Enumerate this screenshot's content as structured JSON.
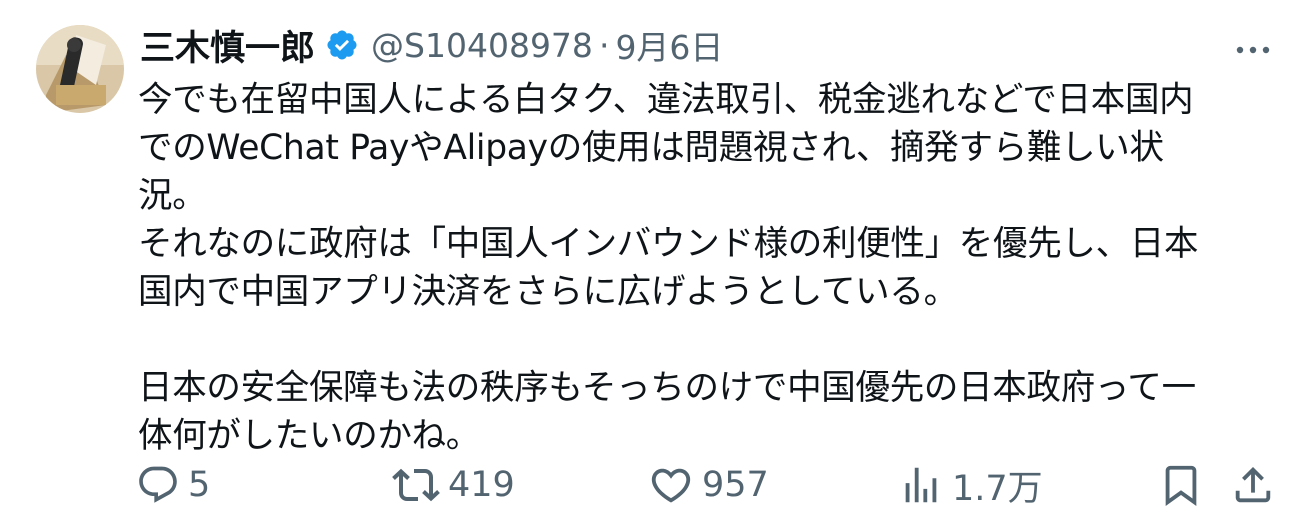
{
  "author": {
    "name": "三木慎一郎",
    "handle": "@S10408978",
    "date": "9月6日",
    "separator": "·",
    "verified": true,
    "verified_color": "#1d9bf0"
  },
  "menu": {
    "icon": "more-dots-icon"
  },
  "tweet": {
    "lines": [
      "今でも在留中国人による白タク、違法取引、税金逃れなどで日本国内",
      "でのWeChat PayやAlipayの使用は問題視され、摘発すら難しい状",
      "況。",
      "それなのに政府は「中国人インバウンド様の利便性」を優先し、日本",
      "国内で中国アプリ決済をさらに広げようとしている。",
      "",
      "日本の安全保障も法の秩序もそっちのけで中国優先の日本政府って一",
      "体何がしたいのかね。"
    ]
  },
  "actions": {
    "reply": {
      "icon": "reply-icon",
      "count": "5"
    },
    "repost": {
      "icon": "repost-icon",
      "count": "419"
    },
    "like": {
      "icon": "heart-icon",
      "count": "957"
    },
    "views": {
      "icon": "views-icon",
      "count": "1.7万"
    },
    "bookmark": {
      "icon": "bookmark-icon"
    },
    "share": {
      "icon": "share-icon"
    }
  },
  "colors": {
    "text": "#0f1419",
    "secondary": "#536471",
    "verified": "#1d9bf0"
  }
}
